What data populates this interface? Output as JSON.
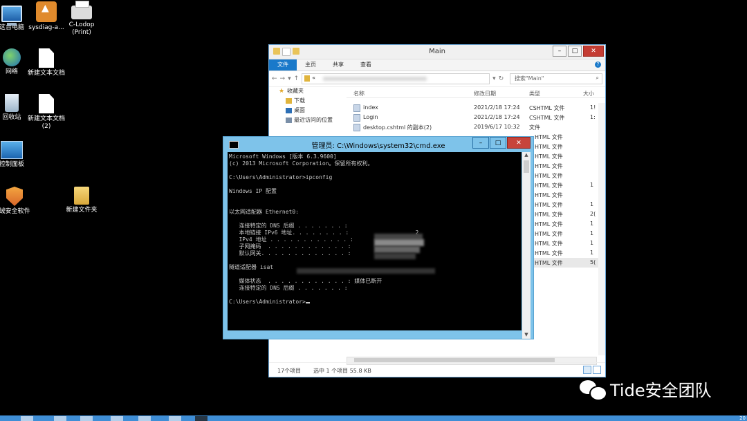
{
  "desktop": {
    "icons": [
      {
        "label": "这台电脑",
        "icon": "computer-icon"
      },
      {
        "label": "sysdiag-a...",
        "icon": "installer-icon"
      },
      {
        "label": "C-Lodop",
        "label2": "(Print)",
        "icon": "printer-icon"
      },
      {
        "label": "网络",
        "icon": "network-icon"
      },
      {
        "label": "新建文本文档",
        "icon": "text-document-icon"
      },
      {
        "label": "回收站",
        "icon": "recycle-bin-icon"
      },
      {
        "label": "新建文本文档",
        "label2": "(2)",
        "icon": "text-document-icon"
      },
      {
        "label": "控制面板",
        "icon": "control-panel-icon"
      },
      {
        "label": "绒安全软件",
        "icon": "security-software-icon"
      },
      {
        "label": "新建文件夹",
        "icon": "folder-icon"
      }
    ]
  },
  "explorer": {
    "title": "Main",
    "ribbon_tabs": [
      "文件",
      "主页",
      "共享",
      "查看"
    ],
    "address_prefix": "«",
    "search_placeholder": "搜索\"Main\"",
    "nav": [
      {
        "label": "收藏夹",
        "level": 0
      },
      {
        "label": "下载",
        "level": 1
      },
      {
        "label": "桌面",
        "level": 1
      },
      {
        "label": "最近访问的位置",
        "level": 1
      }
    ],
    "columns": {
      "name": "名称",
      "date": "修改日期",
      "type": "类型",
      "size": "大小"
    },
    "files": [
      {
        "name": "index",
        "date": "2021/2/18 17:24",
        "type": "CSHTML 文件",
        "size": "1!"
      },
      {
        "name": "Login",
        "date": "2021/2/18 17:24",
        "type": "CSHTML 文件",
        "size": "1:"
      },
      {
        "name": "desktop.cshtml 的副本(2)",
        "date": "2019/6/17 10:32",
        "type": "文件",
        "size": ""
      }
    ],
    "hidden_rows": [
      {
        "type": "HTML 文件",
        "size": ""
      },
      {
        "type": "HTML 文件",
        "size": ""
      },
      {
        "type": "HTML 文件",
        "size": ""
      },
      {
        "type": "HTML 文件",
        "size": ""
      },
      {
        "type": "HTML 文件",
        "size": ""
      },
      {
        "type": "HTML 文件",
        "size": "1"
      },
      {
        "type": "HTML 文件",
        "size": ""
      },
      {
        "type": "HTML 文件",
        "size": "1"
      },
      {
        "type": "HTML 文件",
        "size": "2("
      },
      {
        "type": "HTML 文件",
        "size": "1"
      },
      {
        "type": "HTML 文件",
        "size": "1"
      },
      {
        "type": "HTML 文件",
        "size": "1"
      },
      {
        "type": "HTML 文件",
        "size": "1"
      },
      {
        "type": "HTML 文件",
        "size": "5("
      }
    ],
    "status": {
      "count": "17个项目",
      "selected": "选中 1 个项目 55.8 KB"
    }
  },
  "cmd": {
    "title": "管理员: C:\\Windows\\system32\\cmd.exe",
    "lines": [
      "Microsoft Windows [版本 6.3.9600]",
      "(c) 2013 Microsoft Corporation。保留所有权利。",
      "",
      "C:\\Users\\Administrator>ipconfig",
      "",
      "Windows IP 配置",
      "",
      "",
      "以太网适配器 Ethernet0:",
      "",
      "   连接特定的 DNS 后缀 . . . . . . . :",
      "   本地链接 IPv6 地址. . . . . . . . :                    2",
      "   IPv4 地址 . . . . . . . . . . . . :",
      "   子网掩码  . . . . . . . . . . . . :",
      "   默认网关. . . . . . . . . . . . . :",
      "",
      "隧道适配器 isat",
      "",
      "   媒体状态  . . . . . . . . . . . . : 媒体已断开",
      "   连接特定的 DNS 后缀 . . . . . . . :",
      "",
      "C:\\Users\\Administrator>"
    ]
  },
  "watermark": {
    "text": "Tide安全团队"
  },
  "taskbar": {
    "clock": "20"
  }
}
